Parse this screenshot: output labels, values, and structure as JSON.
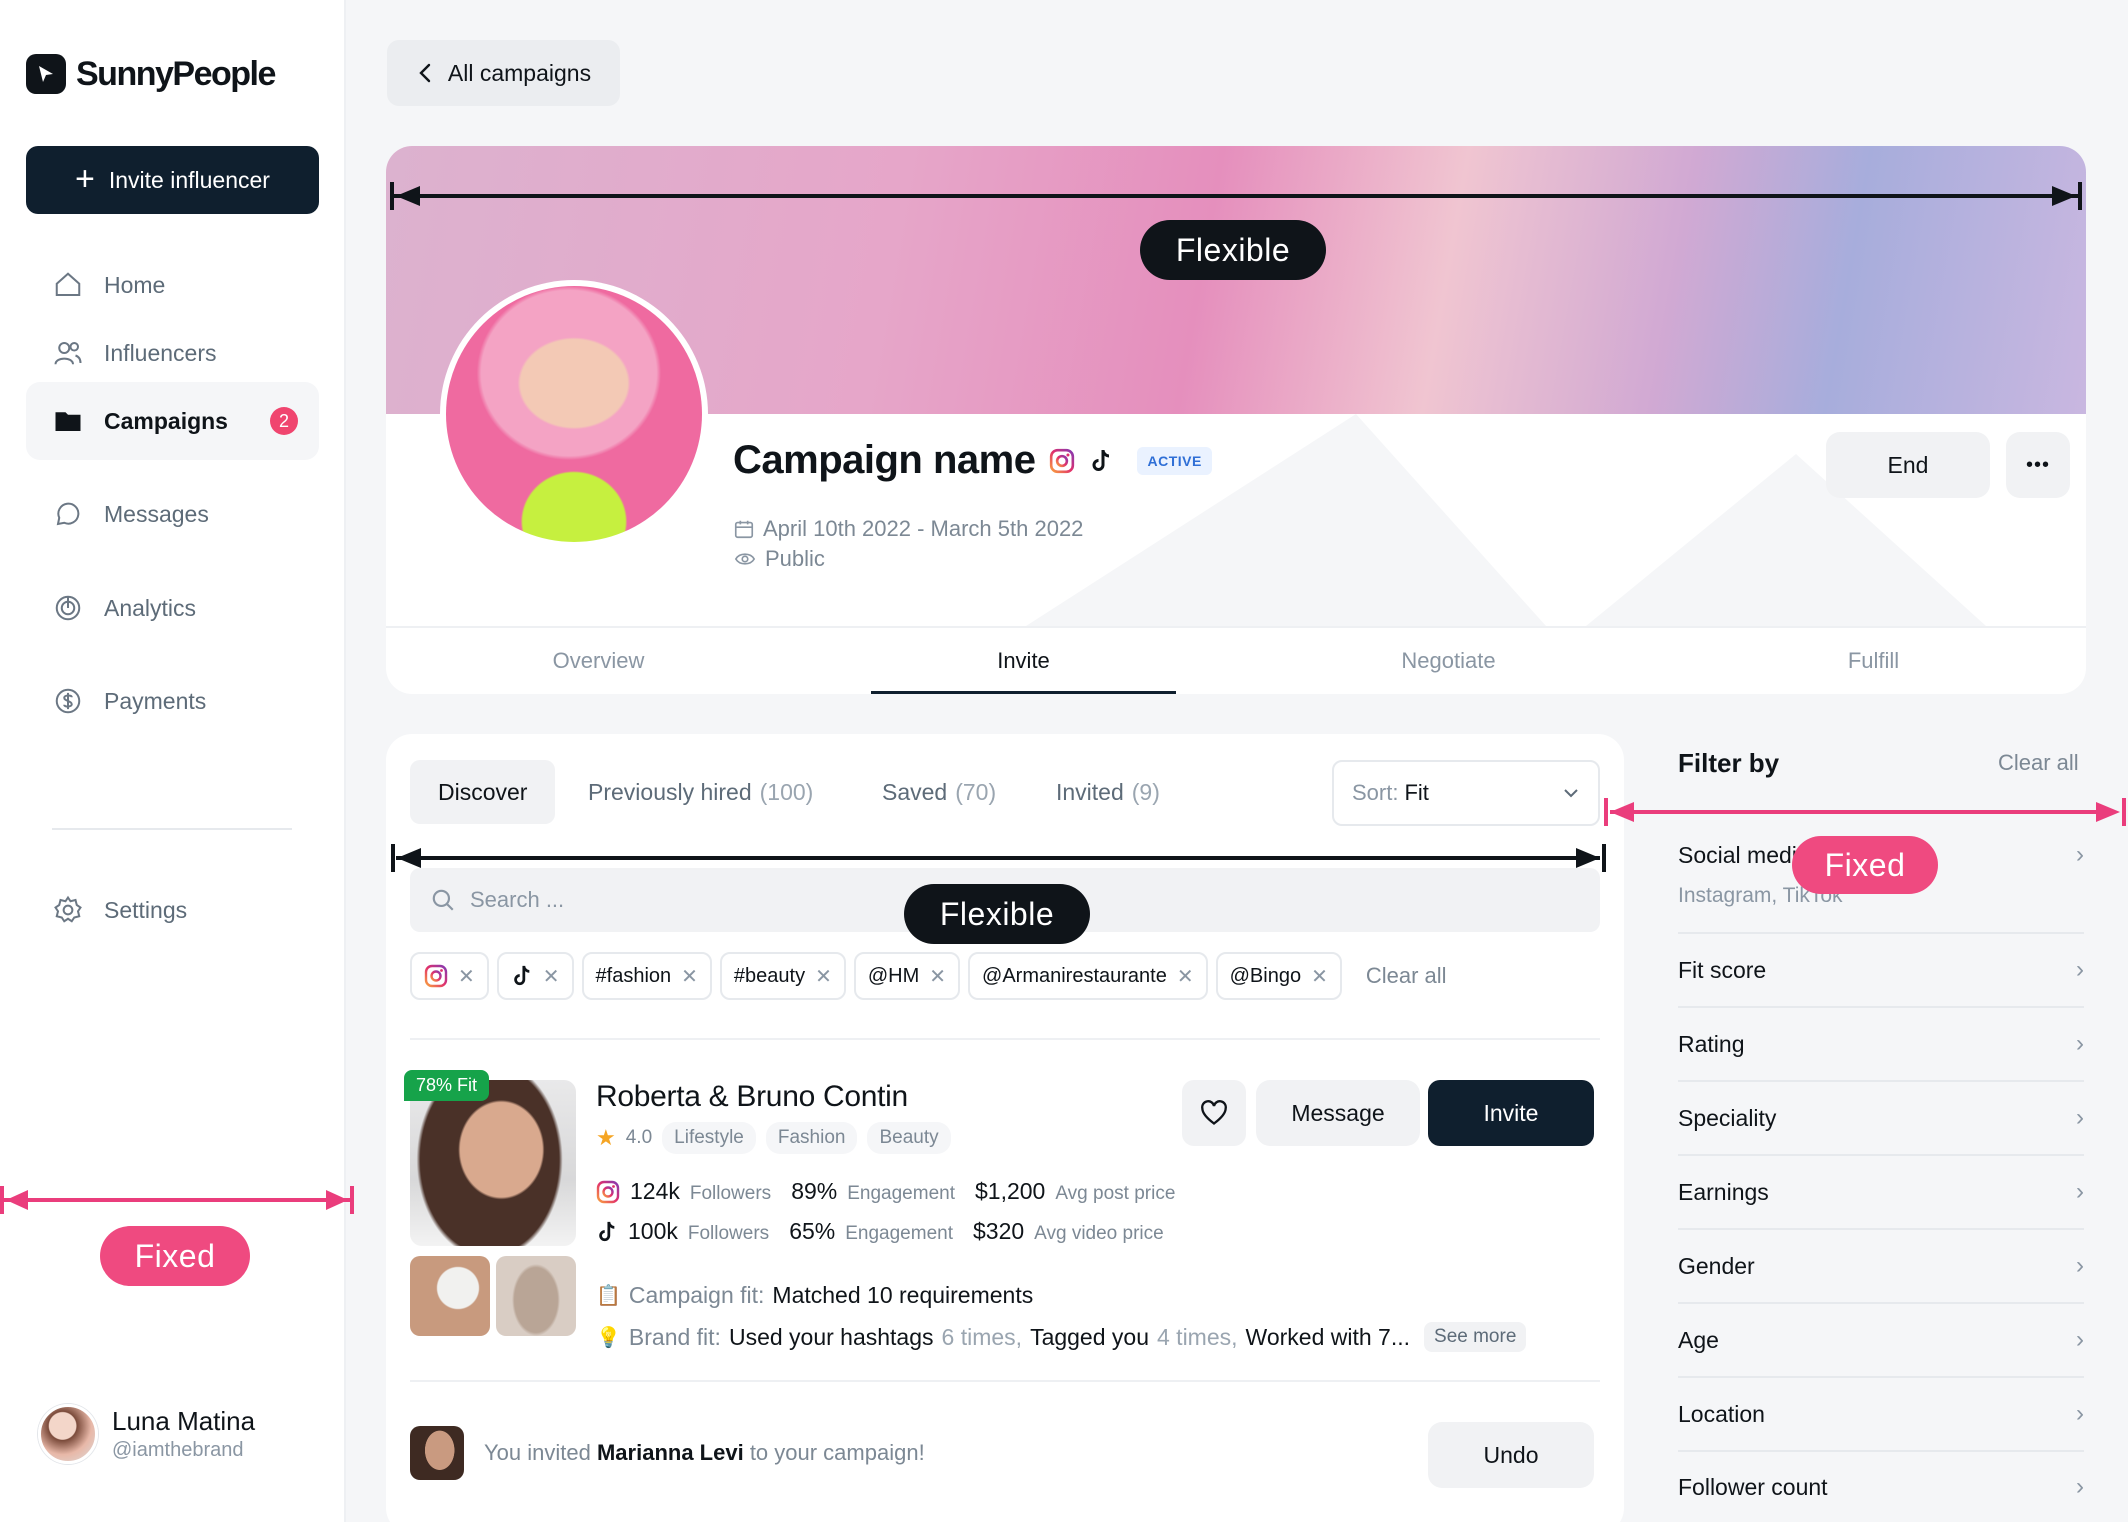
{
  "sidebar": {
    "brand": "SunnyPeople",
    "invite_button": "Invite influencer",
    "nav": [
      {
        "label": "Home"
      },
      {
        "label": "Influencers"
      },
      {
        "label": "Campaigns",
        "badge": "2"
      },
      {
        "label": "Messages"
      },
      {
        "label": "Analytics"
      },
      {
        "label": "Payments"
      }
    ],
    "settings": "Settings",
    "user": {
      "name": "Luna Matina",
      "handle": "@iamthebrand"
    }
  },
  "annotations": {
    "flexible_top": "Flexible",
    "flexible_mid": "Flexible",
    "fixed_sidebar": "Fixed",
    "fixed_filter": "Fixed"
  },
  "back_button": "All campaigns",
  "campaign": {
    "name": "Campaign name",
    "status": "ACTIVE",
    "dates": "April 10th 2022 - March 5th 2022",
    "visibility": "Public",
    "end_button": "End",
    "more_button": "•••",
    "tabs": [
      "Overview",
      "Invite",
      "Negotiate",
      "Fulfill"
    ],
    "active_tab": "Invite"
  },
  "discover": {
    "subtabs": [
      {
        "label": "Discover",
        "count": ""
      },
      {
        "label": "Previously hired",
        "count": "(100)"
      },
      {
        "label": "Saved",
        "count": "(70)"
      },
      {
        "label": "Invited",
        "count": "(9)"
      }
    ],
    "sort_label": "Sort:",
    "sort_value": "Fit",
    "search_placeholder": "Search ...",
    "chips": [
      "#fashion",
      "#beauty",
      "@HM",
      "@Armanirestaurante",
      "@Bingo"
    ],
    "clear_all": "Clear all"
  },
  "influencer": {
    "fit_badge": "78% Fit",
    "name": "Roberta & Bruno Contin",
    "rating": "4.0",
    "tags": [
      "Lifestyle",
      "Fashion",
      "Beauty"
    ],
    "message_button": "Message",
    "invite_button": "Invite",
    "instagram": {
      "followers": "124k",
      "followers_label": "Followers",
      "engagement": "89%",
      "engagement_label": "Engagement",
      "price": "$1,200",
      "price_label": "Avg post price"
    },
    "tiktok": {
      "followers": "100k",
      "followers_label": "Followers",
      "engagement": "65%",
      "engagement_label": "Engagement",
      "price": "$320",
      "price_label": "Avg video price"
    },
    "campaign_fit_label": "Campaign fit:",
    "campaign_fit_value": "Matched 10 requirements",
    "brand_fit_label": "Brand fit:",
    "brand_fit": {
      "p1": "Used your hashtags",
      "n1": "6 times,",
      "p2": "Tagged you",
      "n2": "4 times,",
      "p3": "Worked with 7..."
    },
    "see_more": "See more"
  },
  "notification": {
    "prefix": "You invited",
    "name": "Marianna Levi",
    "suffix": "to your campaign!",
    "undo": "Undo"
  },
  "filter": {
    "title": "Filter by",
    "clear": "Clear all",
    "social_label": "Social media",
    "social_value": "Instagram, TikTok",
    "rows": [
      "Fit score",
      "Rating",
      "Speciality",
      "Earnings",
      "Gender",
      "Age",
      "Location",
      "Follower count"
    ]
  },
  "colors": {
    "primary": "#0f1f2e",
    "accent_pink": "#ef4a80",
    "success": "#16a34a",
    "badge_blue": "#2f6fd6"
  }
}
